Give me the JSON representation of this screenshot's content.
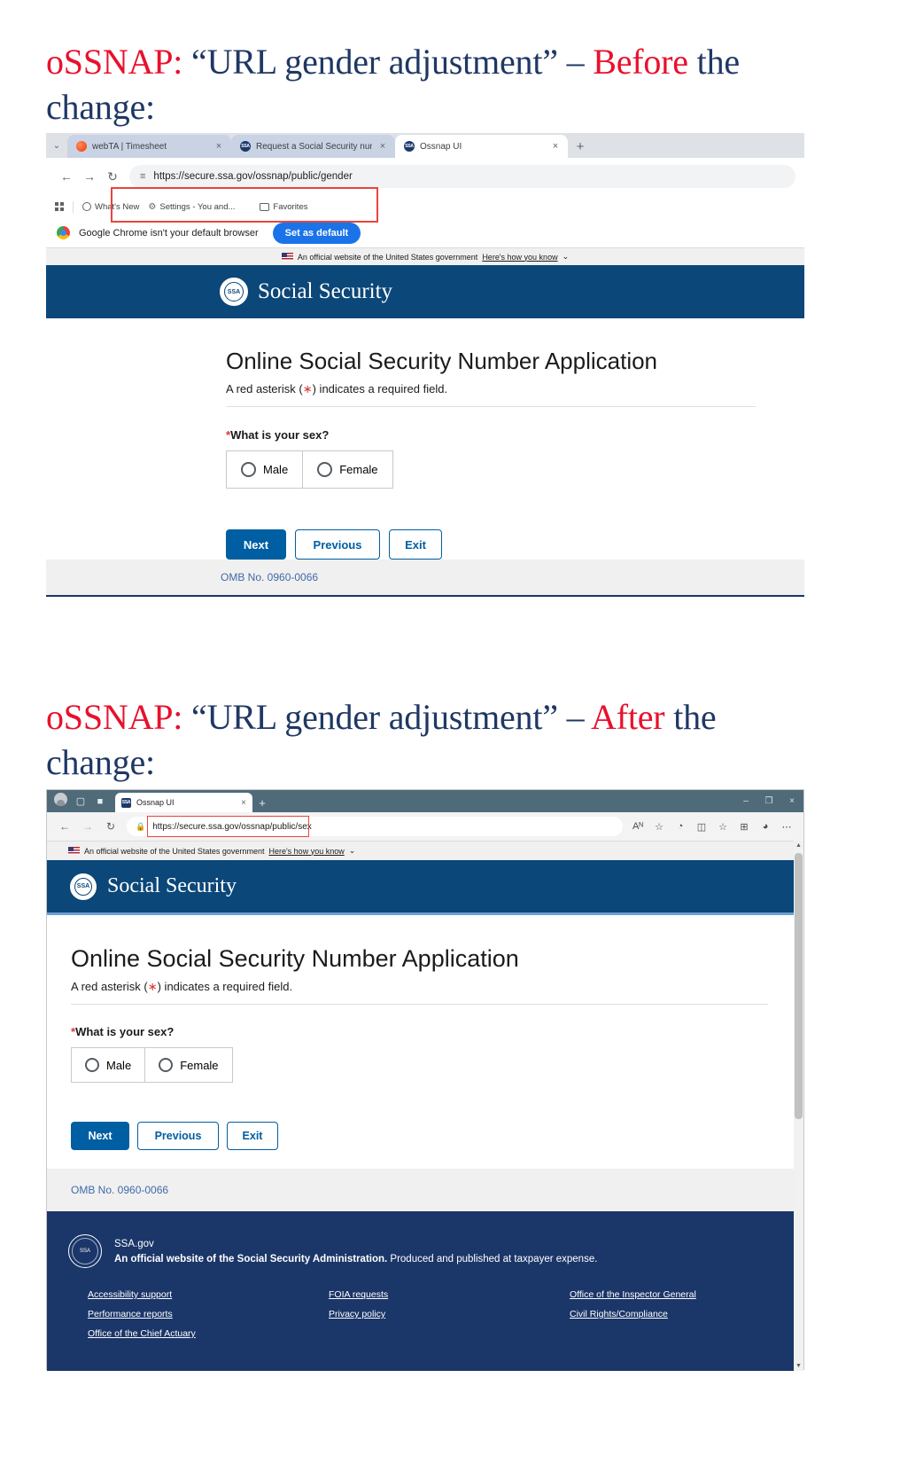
{
  "slide1": {
    "heading_parts": [
      {
        "text": "oSSNAP:",
        "color": "red"
      },
      {
        "text": " “URL gender adjustment” – ",
        "color": "navy"
      },
      {
        "text": "Before",
        "color": "red"
      },
      {
        "text": " the change:",
        "color": "navy"
      }
    ],
    "heading_plain": "oSSNAP: “URL gender adjustment” – Before the change:"
  },
  "slide2": {
    "heading_parts": [
      {
        "text": "oSSNAP:",
        "color": "red"
      },
      {
        "text": " “URL gender adjustment” – ",
        "color": "navy"
      },
      {
        "text": "After",
        "color": "red"
      },
      {
        "text": " the change:",
        "color": "navy"
      }
    ],
    "heading_plain": "oSSNAP: “URL gender adjustment” – After the change:"
  },
  "chrome": {
    "tabs": [
      {
        "title": "webTA | Timesheet",
        "favicon": "webta-icon",
        "active": false,
        "close": "×"
      },
      {
        "title": "Request a Social Security numb",
        "favicon": "ssa-icon",
        "active": false,
        "close": "×"
      },
      {
        "title": "Ossnap UI",
        "favicon": "ssa-icon",
        "active": true,
        "close": "×"
      }
    ],
    "tab_list_chevron": "⌄",
    "new_tab": "+",
    "nav": {
      "back": "←",
      "forward": "→",
      "reload": "↻"
    },
    "omnibox": {
      "site_settings_icon": "≡",
      "url": "https://secure.ssa.gov/ossnap/public/gender"
    },
    "bookmarks": [
      {
        "label": "What's New",
        "icon": "chrome-circle-icon"
      },
      {
        "label": "Settings - You and...",
        "icon": "gear-icon"
      },
      {
        "label": "Favorites",
        "icon": "folder-icon"
      }
    ],
    "infobar": {
      "message": "Google Chrome isn't your default browser",
      "button": "Set as default"
    }
  },
  "edge": {
    "tabs": [
      {
        "title": "Ossnap UI",
        "favicon": "ssa-icon",
        "active": true,
        "close": "×"
      }
    ],
    "new_tab": "+",
    "sys_icons": [
      "profile-avatar",
      "copilot-icon",
      "tab-actions-icon"
    ],
    "window_controls": [
      "–",
      "❐",
      "×"
    ],
    "nav": {
      "back": "←",
      "forward": "→",
      "reload": "↻"
    },
    "omnibox": {
      "lock_icon": "🔒",
      "url": "https://secure.ssa.gov/ossnap/public/sex"
    },
    "toolbar_icons": [
      {
        "name": "read-aloud-icon",
        "glyph": "Aᴺ"
      },
      {
        "name": "favorite-star-icon",
        "glyph": "☆"
      },
      {
        "name": "browser-essentials-icon",
        "glyph": "◔"
      },
      {
        "name": "split-screen-icon",
        "glyph": "◫"
      },
      {
        "name": "favorites-list-icon",
        "glyph": "☆"
      },
      {
        "name": "collections-icon",
        "glyph": "⊞"
      },
      {
        "name": "copilot-icon",
        "glyph": "◕"
      },
      {
        "name": "settings-more-icon",
        "glyph": "⋯"
      }
    ]
  },
  "gov_banner": {
    "text": "An official website of the United States government",
    "link": "Here's how you know",
    "chevron": "⌄"
  },
  "ssa_page": {
    "brand": "Social Security",
    "seal_alt": "ssa-seal-icon",
    "h1": "Online Social Security Number Application",
    "subtitle_before": "A red asterisk (",
    "subtitle_star": "∗",
    "subtitle_after": ") indicates a required field.",
    "question_star": "*",
    "question": "What is your sex?",
    "options": [
      {
        "label": "Male",
        "selected": false
      },
      {
        "label": "Female",
        "selected": false
      }
    ],
    "buttons": [
      {
        "label": "Next",
        "style": "primary"
      },
      {
        "label": "Previous",
        "style": "outline"
      },
      {
        "label": "Exit",
        "style": "outline"
      }
    ],
    "omb": "OMB No. 0960-0066"
  },
  "ssa_footer": {
    "seal_alt": "ssa-footer-seal-icon",
    "site": "SSA.gov",
    "tagline_bold": "An official website of the Social Security Administration.",
    "tagline_rest": " Produced and published at taxpayer expense.",
    "links": [
      "Accessibility support",
      "FOIA requests",
      "Office of the Inspector General",
      "Performance reports",
      "Privacy policy",
      "Civil Rights/Compliance",
      "Office of the Chief Actuary"
    ]
  },
  "colors": {
    "heading_navy": "#1F3864",
    "heading_red": "#E8112D",
    "ssa_blue": "#0B4778",
    "ssa_button_blue": "#005EA2",
    "footer_navy": "#1B3668",
    "highlight_box": "#E8453C"
  }
}
